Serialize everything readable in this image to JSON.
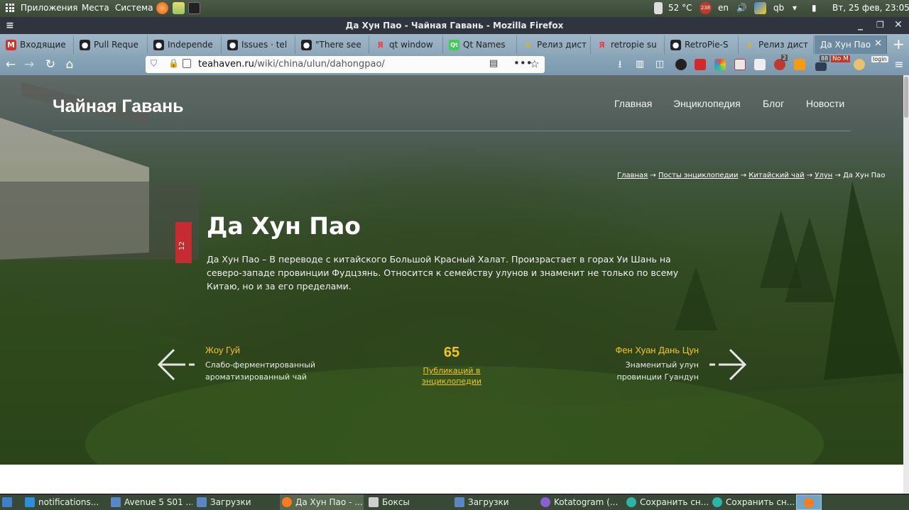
{
  "system_panel": {
    "menu_apps": "Приложения",
    "menu_places": "Места",
    "menu_system": "Система",
    "temperature": "52 °C",
    "badge_count": "238",
    "keyboard_layout": "en",
    "clock": "Вт, 25 фев, 23:05"
  },
  "window": {
    "title": "Да Хун Пао - Чайная Гавань - Mozilla Firefox"
  },
  "tabs": [
    {
      "label": "Входящие",
      "icon": "mail-icon",
      "color": "#d93025",
      "glyph": "M"
    },
    {
      "label": "Pull Reque",
      "icon": "github-icon",
      "color": "#222222",
      "glyph": "●"
    },
    {
      "label": "Independe",
      "icon": "github-icon",
      "color": "#222222",
      "glyph": "●"
    },
    {
      "label": "Issues · tel",
      "icon": "github-icon",
      "color": "#222222",
      "glyph": "●"
    },
    {
      "label": "\"There see",
      "icon": "github-icon",
      "color": "#222222",
      "glyph": "●"
    },
    {
      "label": "qt window",
      "icon": "yandex-icon",
      "color": "#ff3333",
      "glyph": "Я"
    },
    {
      "label": "Qt Names",
      "icon": "qt-icon",
      "color": "#41cd52",
      "glyph": "Qt"
    },
    {
      "label": "Релиз дист",
      "icon": "star-icon",
      "color": "#e0b020",
      "glyph": "★"
    },
    {
      "label": "retropie su",
      "icon": "yandex-icon",
      "color": "#ff3333",
      "glyph": "Я"
    },
    {
      "label": "RetroPie-S",
      "icon": "github-icon",
      "color": "#222222",
      "glyph": "●"
    },
    {
      "label": "Релиз дист",
      "icon": "star-icon",
      "color": "#e0b020",
      "glyph": "★"
    },
    {
      "label": "Да Хун Пао",
      "icon": "tea-icon",
      "color": "#6d8ba0",
      "glyph": ""
    }
  ],
  "url": {
    "host": "teahaven.ru",
    "path": "/wiki/china/ulun/dahongpao/"
  },
  "ext_badges": {
    "b1": "2",
    "b2": "88",
    "b3": "No M",
    "login": "login"
  },
  "site": {
    "title": "Чайная Гавань",
    "menu": [
      "Главная",
      "Энциклопедия",
      "Блог",
      "Новости"
    ]
  },
  "breadcrumb": {
    "items": [
      "Главная",
      "Посты энциклопедии",
      "Китайский чай",
      "Улун"
    ],
    "current": "Да Хун Пао",
    "sep": "→"
  },
  "article": {
    "tag_number": "12",
    "title": "Да Хун Пао",
    "description": "Да Хун Пао – В переводе с китайского Большой Красный Халат. Произрастает в горах Уи Шань на северо-западе провинции Фудцзянь. Относится к семейству улунов и знаменит не только по всему Китаю, но и за его пределами."
  },
  "prev": {
    "title": "Жоу Гуй",
    "sub1": "Слабо-ферментированный",
    "sub2": "ароматизированный чай"
  },
  "next": {
    "title": "Фен Хуан Дань Цун",
    "sub1": "Знаменитый улун",
    "sub2": "провинции Гуандун"
  },
  "count": {
    "number": "65",
    "label1": "Публикаций в",
    "label2": "энциклопедии"
  },
  "taskbar": [
    {
      "label": "",
      "icon": "menu-icon",
      "color": "#3f7fd0"
    },
    {
      "label": "notifications...",
      "icon": "vscode-icon",
      "color": "#2a8fe0"
    },
    {
      "label": "Avenue 5 S01 ...",
      "icon": "folder-icon",
      "color": "#5a86c6"
    },
    {
      "label": "Загрузки",
      "icon": "folder-icon",
      "color": "#5a86c6"
    },
    {
      "label": "Да Хун Пао - ...",
      "icon": "firefox-icon",
      "color": "#ff7a1a"
    },
    {
      "label": "Боксы",
      "icon": "boxes-icon",
      "color": "#cfcfcf"
    },
    {
      "label": "Загрузки",
      "icon": "folder-icon",
      "color": "#5a86c6"
    },
    {
      "label": "Kotatogram (...",
      "icon": "telegram-icon",
      "color": "#8a5fd0"
    },
    {
      "label": "Сохранить сн...",
      "icon": "screenshot-icon",
      "color": "#2cb5a8"
    },
    {
      "label": "Сохранить сн...",
      "icon": "screenshot-icon",
      "color": "#2cb5a8"
    },
    {
      "label": "",
      "icon": "firefox-icon",
      "color": "#ff7a1a"
    }
  ]
}
